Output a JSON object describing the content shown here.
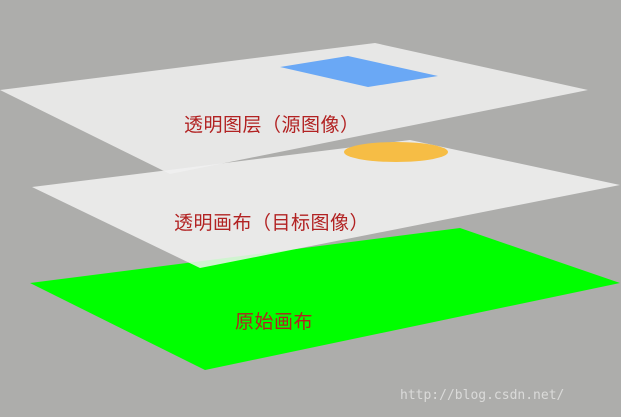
{
  "labels": {
    "transparent_layer": "透明图层（源图像）",
    "transparent_canvas": "透明画布（目标图像）",
    "original_canvas": "原始画布"
  },
  "watermark": "http://blog.csdn.net/",
  "colors": {
    "background": "#adadab",
    "label_text": "#b22222",
    "original_canvas_fill": "#00ff00",
    "layer_fill": "#eeeeee",
    "source_shape_fill": "#6aa8f5",
    "target_shape_fill": "#f6bd45"
  }
}
